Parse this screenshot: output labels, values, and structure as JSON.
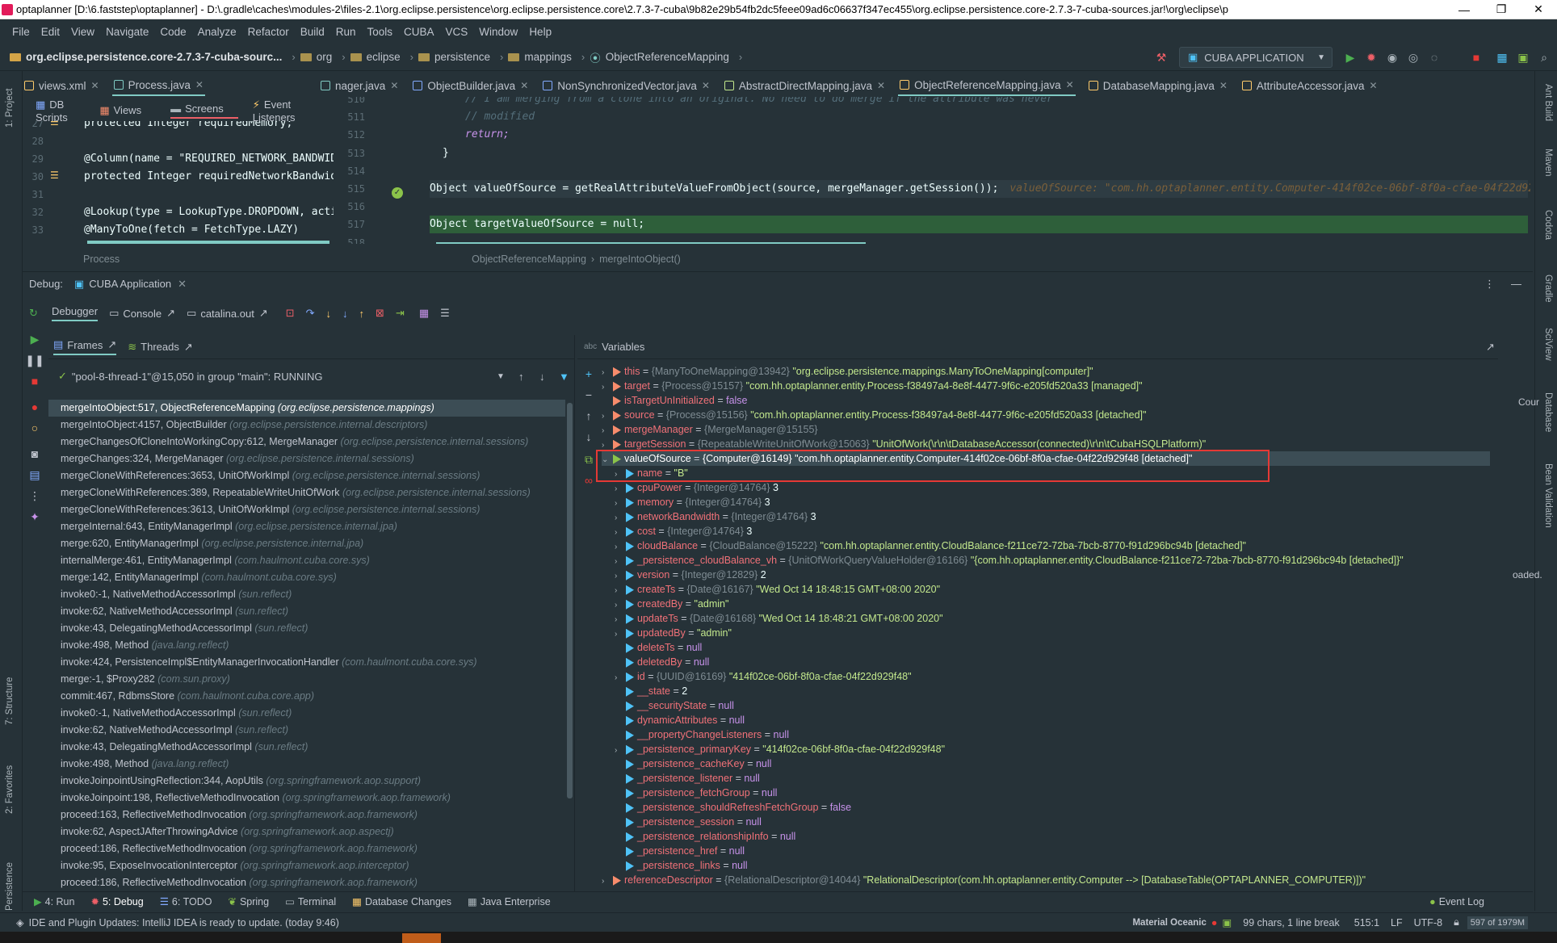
{
  "window": {
    "title": "optaplanner [D:\\6.faststep\\optaplanner] - D:\\.gradle\\caches\\modules-2\\files-2.1\\org.eclipse.persistence\\org.eclipse.persistence.core\\2.7.3-7-cuba\\9b82e29b54fb2dc5feee09ad6c06637f347ec455\\org.eclipse.persistence.core-2.7.3-7-cuba-sources.jar!\\org\\eclipse\\p",
    "minimize": "—",
    "maximize": "❐",
    "close": "✕"
  },
  "menu": [
    "File",
    "Edit",
    "View",
    "Navigate",
    "Code",
    "Analyze",
    "Refactor",
    "Build",
    "Run",
    "Tools",
    "CUBA",
    "VCS",
    "Window",
    "Help"
  ],
  "navbar": {
    "jar": "org.eclipse.persistence.core-2.7.3-7-cuba-sourc...",
    "crumbs": [
      "org",
      "eclipse",
      "persistence",
      "mappings",
      "ObjectReferenceMapping"
    ],
    "run_config": "CUBA APPLICATION"
  },
  "left_tabs": [
    {
      "label": "views.xml",
      "close": "✕"
    },
    {
      "label": "Process.java",
      "close": "✕"
    }
  ],
  "right_tabs": [
    {
      "label": "nager.java",
      "close": "✕"
    },
    {
      "label": "ObjectBuilder.java",
      "close": "✕"
    },
    {
      "label": "NonSynchronizedVector.java",
      "close": "✕"
    },
    {
      "label": "AbstractDirectMapping.java",
      "close": "✕"
    },
    {
      "label": "ObjectReferenceMapping.java",
      "close": "✕"
    },
    {
      "label": "DatabaseMapping.java",
      "close": "✕"
    },
    {
      "label": "AttributeAccessor.java",
      "close": "✕"
    }
  ],
  "design_tabs": [
    "DB Scripts",
    "Views",
    "Screens",
    "Event Listeners"
  ],
  "code1": {
    "lines": [
      {
        "num": "27",
        "text": "protected Integer requiredMemory;"
      },
      {
        "num": "28",
        "text": ""
      },
      {
        "num": "29",
        "text": "@Column(name = \"REQUIRED_NETWORK_BANDWID"
      },
      {
        "num": "30",
        "text": "protected Integer requiredNetworkBandwid"
      },
      {
        "num": "31",
        "text": ""
      },
      {
        "num": "32",
        "text": "@Lookup(type = LookupType.DROPDOWN, actio"
      },
      {
        "num": "33",
        "text": "@ManyToOne(fetch = FetchType.LAZY)"
      }
    ],
    "footer": "Process"
  },
  "code2": {
    "lines": [
      {
        "num": "510",
        "text": "// I am merging from a clone into an original.  No need to do merge if the attribute was never"
      },
      {
        "num": "511",
        "text": "// modified"
      },
      {
        "num": "512",
        "text": "return;"
      },
      {
        "num": "513",
        "text": "}"
      },
      {
        "num": "514",
        "text": ""
      },
      {
        "num": "515",
        "text": "Object valueOfSource = getRealAttributeValueFromObject(source, mergeManager.getSession());",
        "hint": "valueOfSource: \"com.hh.optaplanner.entity.Computer-414f02ce-06bf-8f0a-cfae-04f22d929f48 [detach"
      },
      {
        "num": "516",
        "text": ""
      },
      {
        "num": "517",
        "text": "Object targetValueOfSource = null;"
      },
      {
        "num": "518",
        "text": ""
      }
    ],
    "breadcrumb": [
      "ObjectReferenceMapping",
      "mergeIntoObject()"
    ]
  },
  "debug": {
    "label": "Debug:",
    "session": "CUBA Application",
    "tabs": [
      "Debugger",
      "Console",
      "catalina.out"
    ],
    "frames_tab": "Frames",
    "threads_tab": "Threads",
    "thread": "\"pool-8-thread-1\"@15,050 in group \"main\": RUNNING",
    "variables_label": "Variables",
    "right_peek": "Cour",
    "right_peek2": "oaded.",
    "frames": [
      {
        "m": "mergeIntoObject:517, ObjectReferenceMapping",
        "p": "(org.eclipse.persistence.mappings)"
      },
      {
        "m": "mergeIntoObject:4157, ObjectBuilder",
        "p": "(org.eclipse.persistence.internal.descriptors)"
      },
      {
        "m": "mergeChangesOfCloneIntoWorkingCopy:612, MergeManager",
        "p": "(org.eclipse.persistence.internal.sessions)"
      },
      {
        "m": "mergeChanges:324, MergeManager",
        "p": "(org.eclipse.persistence.internal.sessions)"
      },
      {
        "m": "mergeCloneWithReferences:3653, UnitOfWorkImpl",
        "p": "(org.eclipse.persistence.internal.sessions)"
      },
      {
        "m": "mergeCloneWithReferences:389, RepeatableWriteUnitOfWork",
        "p": "(org.eclipse.persistence.internal.sessions)"
      },
      {
        "m": "mergeCloneWithReferences:3613, UnitOfWorkImpl",
        "p": "(org.eclipse.persistence.internal.sessions)"
      },
      {
        "m": "mergeInternal:643, EntityManagerImpl",
        "p": "(org.eclipse.persistence.internal.jpa)"
      },
      {
        "m": "merge:620, EntityManagerImpl",
        "p": "(org.eclipse.persistence.internal.jpa)"
      },
      {
        "m": "internalMerge:461, EntityManagerImpl",
        "p": "(com.haulmont.cuba.core.sys)"
      },
      {
        "m": "merge:142, EntityManagerImpl",
        "p": "(com.haulmont.cuba.core.sys)"
      },
      {
        "m": "invoke0:-1, NativeMethodAccessorImpl",
        "p": "(sun.reflect)"
      },
      {
        "m": "invoke:62, NativeMethodAccessorImpl",
        "p": "(sun.reflect)"
      },
      {
        "m": "invoke:43, DelegatingMethodAccessorImpl",
        "p": "(sun.reflect)"
      },
      {
        "m": "invoke:498, Method",
        "p": "(java.lang.reflect)"
      },
      {
        "m": "invoke:424, PersistenceImpl$EntityManagerInvocationHandler",
        "p": "(com.haulmont.cuba.core.sys)"
      },
      {
        "m": "merge:-1, $Proxy282",
        "p": "(com.sun.proxy)"
      },
      {
        "m": "commit:467, RdbmsStore",
        "p": "(com.haulmont.cuba.core.app)"
      },
      {
        "m": "invoke0:-1, NativeMethodAccessorImpl",
        "p": "(sun.reflect)"
      },
      {
        "m": "invoke:62, NativeMethodAccessorImpl",
        "p": "(sun.reflect)"
      },
      {
        "m": "invoke:43, DelegatingMethodAccessorImpl",
        "p": "(sun.reflect)"
      },
      {
        "m": "invoke:498, Method",
        "p": "(java.lang.reflect)"
      },
      {
        "m": "invokeJoinpointUsingReflection:344, AopUtils",
        "p": "(org.springframework.aop.support)"
      },
      {
        "m": "invokeJoinpoint:198, ReflectiveMethodInvocation",
        "p": "(org.springframework.aop.framework)"
      },
      {
        "m": "proceed:163, ReflectiveMethodInvocation",
        "p": "(org.springframework.aop.framework)"
      },
      {
        "m": "invoke:62, AspectJAfterThrowingAdvice",
        "p": "(org.springframework.aop.aspectj)"
      },
      {
        "m": "proceed:186, ReflectiveMethodInvocation",
        "p": "(org.springframework.aop.framework)"
      },
      {
        "m": "invoke:95, ExposeInvocationInterceptor",
        "p": "(org.springframework.aop.interceptor)"
      },
      {
        "m": "proceed:186, ReflectiveMethodInvocation",
        "p": "(org.springframework.aop.framework)"
      }
    ],
    "variables": [
      {
        "indent": 0,
        "exp": "›",
        "name": "this",
        "type": "{ManyToOneMapping@13942}",
        "val": "\"org.eclipse.persistence.mappings.ManyToOneMapping[computer]\""
      },
      {
        "indent": 0,
        "exp": "›",
        "name": "target",
        "type": "{Process@15157}",
        "val": "\"com.hh.optaplanner.entity.Process-f38497a4-8e8f-4477-9f6c-e205fd520a33 [managed]\""
      },
      {
        "indent": 0,
        "exp": "",
        "name": "isTargetUnInitialized",
        "type": "",
        "val": "false"
      },
      {
        "indent": 0,
        "exp": "›",
        "name": "source",
        "type": "{Process@15156}",
        "val": "\"com.hh.optaplanner.entity.Process-f38497a4-8e8f-4477-9f6c-e205fd520a33 [detached]\""
      },
      {
        "indent": 0,
        "exp": "›",
        "name": "mergeManager",
        "type": "{MergeManager@15155}",
        "val": ""
      },
      {
        "indent": 0,
        "exp": "›",
        "name": "targetSession",
        "type": "{RepeatableWriteUnitOfWork@15063}",
        "val": "\"UnitOfWork(\\r\\n\\tDatabaseAccessor(connected)\\r\\n\\tCubaHSQLPlatform)\""
      },
      {
        "indent": 0,
        "exp": "⌄",
        "name": "valueOfSource",
        "type": "{Computer@16149}",
        "val": "\"com.hh.optaplanner.entity.Computer-414f02ce-06bf-8f0a-cfae-04f22d929f48 [detached]\"",
        "sel": true
      },
      {
        "indent": 1,
        "exp": "›",
        "name": "name",
        "type": "",
        "val": "\"B\""
      },
      {
        "indent": 1,
        "exp": "›",
        "name": "cpuPower",
        "type": "{Integer@14764}",
        "val": "3"
      },
      {
        "indent": 1,
        "exp": "›",
        "name": "memory",
        "type": "{Integer@14764}",
        "val": "3"
      },
      {
        "indent": 1,
        "exp": "›",
        "name": "networkBandwidth",
        "type": "{Integer@14764}",
        "val": "3"
      },
      {
        "indent": 1,
        "exp": "›",
        "name": "cost",
        "type": "{Integer@14764}",
        "val": "3"
      },
      {
        "indent": 1,
        "exp": "›",
        "name": "cloudBalance",
        "type": "{CloudBalance@15222}",
        "val": "\"com.hh.optaplanner.entity.CloudBalance-f211ce72-72ba-7bcb-8770-f91d296bc94b [detached]\""
      },
      {
        "indent": 1,
        "exp": "›",
        "name": "_persistence_cloudBalance_vh",
        "type": "{UnitOfWorkQueryValueHolder@16166}",
        "val": "\"{com.hh.optaplanner.entity.CloudBalance-f211ce72-72ba-7bcb-8770-f91d296bc94b [detached]}\""
      },
      {
        "indent": 1,
        "exp": "›",
        "name": "version",
        "type": "{Integer@12829}",
        "val": "2"
      },
      {
        "indent": 1,
        "exp": "›",
        "name": "createTs",
        "type": "{Date@16167}",
        "val": "\"Wed Oct 14 18:48:15 GMT+08:00 2020\""
      },
      {
        "indent": 1,
        "exp": "›",
        "name": "createdBy",
        "type": "",
        "val": "\"admin\""
      },
      {
        "indent": 1,
        "exp": "›",
        "name": "updateTs",
        "type": "{Date@16168}",
        "val": "\"Wed Oct 14 18:48:21 GMT+08:00 2020\""
      },
      {
        "indent": 1,
        "exp": "›",
        "name": "updatedBy",
        "type": "",
        "val": "\"admin\""
      },
      {
        "indent": 1,
        "exp": "",
        "name": "deleteTs",
        "type": "",
        "val": "null"
      },
      {
        "indent": 1,
        "exp": "",
        "name": "deletedBy",
        "type": "",
        "val": "null"
      },
      {
        "indent": 1,
        "exp": "›",
        "name": "id",
        "type": "{UUID@16169}",
        "val": "\"414f02ce-06bf-8f0a-cfae-04f22d929f48\""
      },
      {
        "indent": 1,
        "exp": "",
        "name": "__state",
        "type": "",
        "val": "2"
      },
      {
        "indent": 1,
        "exp": "",
        "name": "__securityState",
        "type": "",
        "val": "null"
      },
      {
        "indent": 1,
        "exp": "",
        "name": "dynamicAttributes",
        "type": "",
        "val": "null"
      },
      {
        "indent": 1,
        "exp": "",
        "name": "__propertyChangeListeners",
        "type": "",
        "val": "null"
      },
      {
        "indent": 1,
        "exp": "›",
        "name": "_persistence_primaryKey",
        "type": "",
        "val": "\"414f02ce-06bf-8f0a-cfae-04f22d929f48\""
      },
      {
        "indent": 1,
        "exp": "",
        "name": "_persistence_cacheKey",
        "type": "",
        "val": "null"
      },
      {
        "indent": 1,
        "exp": "",
        "name": "_persistence_listener",
        "type": "",
        "val": "null"
      },
      {
        "indent": 1,
        "exp": "",
        "name": "_persistence_fetchGroup",
        "type": "",
        "val": "null"
      },
      {
        "indent": 1,
        "exp": "",
        "name": "_persistence_shouldRefreshFetchGroup",
        "type": "",
        "val": "false"
      },
      {
        "indent": 1,
        "exp": "",
        "name": "_persistence_session",
        "type": "",
        "val": "null"
      },
      {
        "indent": 1,
        "exp": "",
        "name": "_persistence_relationshipInfo",
        "type": "",
        "val": "null"
      },
      {
        "indent": 1,
        "exp": "",
        "name": "_persistence_href",
        "type": "",
        "val": "null"
      },
      {
        "indent": 1,
        "exp": "",
        "name": "_persistence_links",
        "type": "",
        "val": "null"
      },
      {
        "indent": 0,
        "exp": "›",
        "name": "referenceDescriptor",
        "type": "{RelationalDescriptor@14044}",
        "val": "\"RelationalDescriptor(com.hh.optaplanner.entity.Computer --> [DatabaseTable(OPTAPLANNER_COMPUTER)])\""
      }
    ]
  },
  "bottom_tools": [
    "4: Run",
    "5: Debug",
    "6: TODO",
    "Spring",
    "Terminal",
    "Database Changes",
    "Java Enterprise"
  ],
  "event_log": "Event Log",
  "left_strip": [
    "1: Project",
    "7: Structure",
    "2: Favorites",
    "Persistence"
  ],
  "right_strip": [
    "Ant Build",
    "Maven",
    "Codota",
    "Gradle",
    "SciView",
    "Database",
    "Bean Validation"
  ],
  "status": {
    "message": "IDE and Plugin Updates: IntelliJ IDEA is ready to update. (today 9:46)",
    "theme": "Material Oceanic",
    "chars": "99 chars, 1 line break",
    "pos": "515:1",
    "lf": "LF",
    "enc": "UTF-8",
    "mem": "597 of 1979M"
  }
}
